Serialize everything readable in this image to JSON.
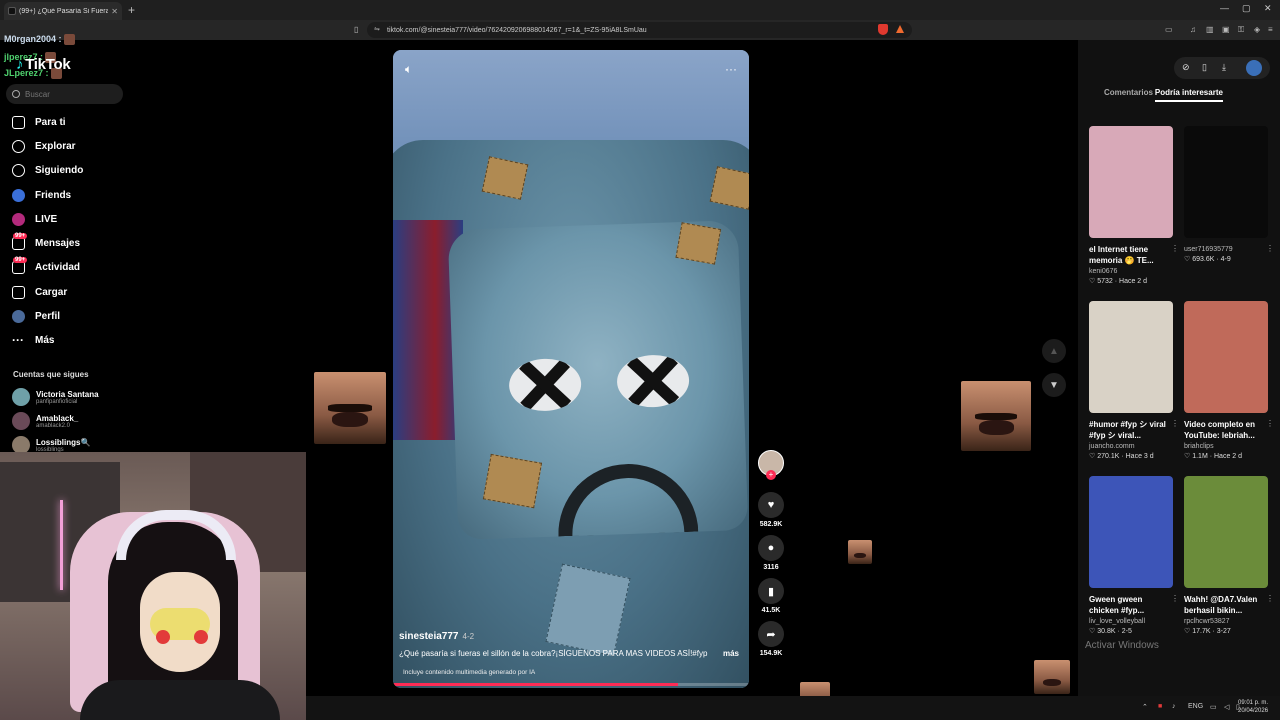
{
  "browser": {
    "tab_title": "(99+) ¿Qué Pasaría Si Fuera el...",
    "url": "tiktok.com/@sinesteia777/video/7624209206988014267_r=1&_t=ZS-95iA8LSmUau"
  },
  "chat": [
    {
      "user": "M0rgan2004 :",
      "color": "#cde"
    },
    {
      "user": "jlperez7 :",
      "color": "#4fd16e"
    },
    {
      "user": "JLperez7 :",
      "color": "#4fd16e"
    }
  ],
  "sidebar": {
    "logo": "TikTok",
    "search_placeholder": "Buscar",
    "nav": [
      {
        "label": "Para ti",
        "icon": "home-icon"
      },
      {
        "label": "Explorar",
        "icon": "compass-icon"
      },
      {
        "label": "Siguiendo",
        "icon": "following-icon"
      },
      {
        "label": "Friends",
        "icon": "friends-icon"
      },
      {
        "label": "LIVE",
        "icon": "live-icon"
      },
      {
        "label": "Mensajes",
        "icon": "messages-icon",
        "badge": "99+"
      },
      {
        "label": "Actividad",
        "icon": "activity-icon",
        "badge": "99+"
      },
      {
        "label": "Cargar",
        "icon": "upload-icon"
      },
      {
        "label": "Perfil",
        "icon": "profile-icon"
      },
      {
        "label": "Más",
        "icon": "more-icon"
      }
    ],
    "following_title": "Cuentas que sigues",
    "following": [
      {
        "name": "Victoria Santana",
        "handle": "panfipanfioficial"
      },
      {
        "name": "Amablack_",
        "handle": "amablack2.0"
      },
      {
        "name": "Lossiblings🔍",
        "handle": "lossiblings"
      }
    ]
  },
  "video": {
    "username": "sinesteia777",
    "date": "4-2",
    "description": "¿Qué pasaría si fueras el sillón de la cobra?¡SÍGUENOS PARA MAS VIDEOS ASÍ!#fyp ...",
    "more": "más",
    "ai_notice": "Incluye contenido multimedia generado por IA",
    "progress": 0.8
  },
  "actions": {
    "likes": "582.9K",
    "comments": "3116",
    "saves": "41.5K",
    "shares": "154.9K"
  },
  "right_panel": {
    "tab_comments": "Comentarios",
    "tab_recommended": "Podría interesarte",
    "cards": [
      {
        "title": "el Internet tiene memoria 🤭 TE...",
        "user": "keni0676",
        "meta": "♡ 5732 · Hace 2 d",
        "bg": "#d8a9b8"
      },
      {
        "title": "",
        "user": "user716935779",
        "meta": "♡ 693.6K · 4-9",
        "bg": "#0a0a0a"
      },
      {
        "title": "#humor #fyp シ viral #fyp シ viral...",
        "user": "juancho.comm",
        "meta": "♡ 270.1K · Hace 3 d",
        "bg": "#d9d2c6"
      },
      {
        "title": "Video completo en YouTube: lebriah...",
        "user": "briahclips",
        "meta": "♡ 1.1M · Hace 2 d",
        "bg": "#c06a5a"
      },
      {
        "title": "Gween gween chicken #fyp...",
        "user": "liv_love_volleyball",
        "meta": "♡ 30.8K · 2-5",
        "bg": "#3d55b8"
      },
      {
        "title": "Wahh! @DA7.Valen berhasil bikin...",
        "user": "rpclhcwr53827",
        "meta": "♡ 17.7K · 3-27",
        "bg": "#6b8c3a"
      }
    ]
  },
  "windows": {
    "activate": "Activar Windows",
    "lang": "ENG",
    "time": "09:01 p. m.",
    "date": "20/04/2026"
  }
}
